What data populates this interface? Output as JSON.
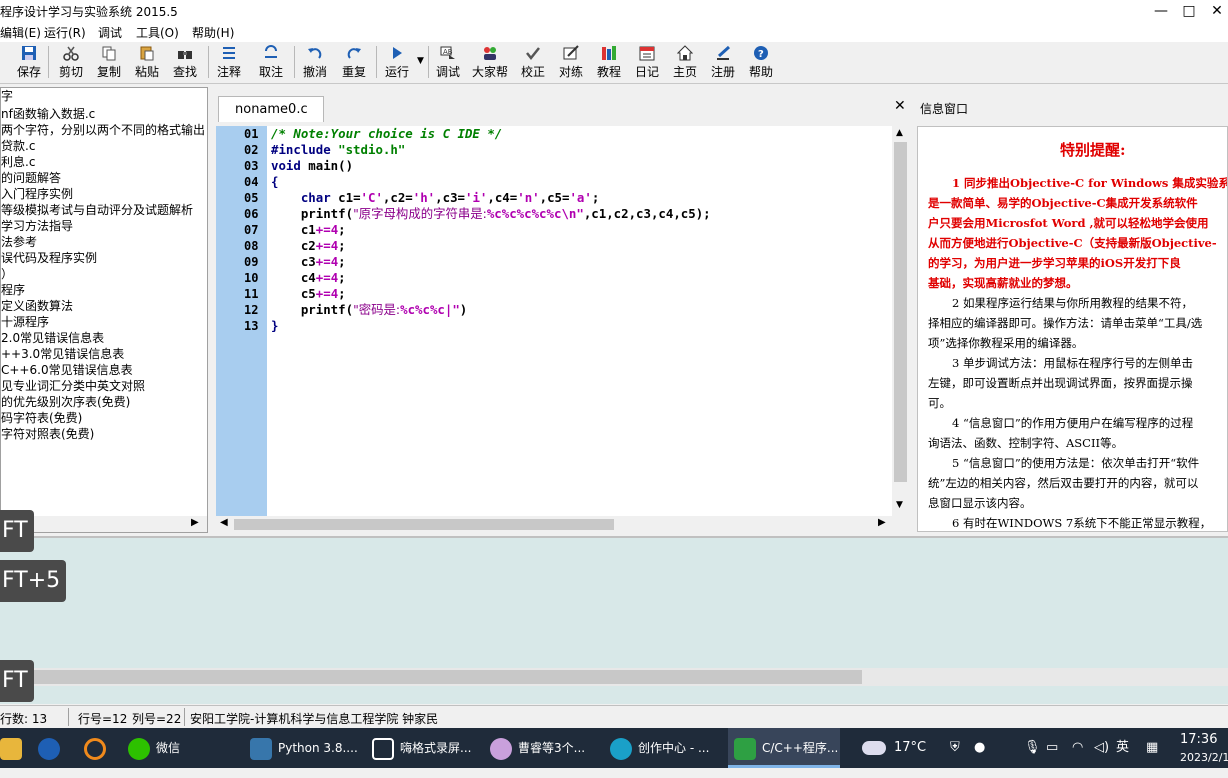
{
  "window": {
    "title": "程序设计学习与实验系统 2015.5",
    "controls": [
      "—",
      "□",
      "✕"
    ]
  },
  "menu": [
    {
      "label": "编辑(E)"
    },
    {
      "label": "运行(R)"
    },
    {
      "label": "调试"
    },
    {
      "label": "工具(O)"
    },
    {
      "label": "帮助(H)"
    }
  ],
  "toolbar": [
    {
      "label": "保存",
      "icon": "save-icon"
    },
    {
      "label": "剪切",
      "icon": "cut-icon"
    },
    {
      "label": "复制",
      "icon": "copy-icon"
    },
    {
      "label": "粘贴",
      "icon": "paste-icon"
    },
    {
      "label": "查找",
      "icon": "find-icon"
    },
    {
      "label": "注释",
      "icon": "comment-icon"
    },
    {
      "label": "取注",
      "icon": "uncomment-icon"
    },
    {
      "label": "撤消",
      "icon": "undo-icon"
    },
    {
      "label": "重复",
      "icon": "redo-icon"
    },
    {
      "label": "运行",
      "icon": "run-icon"
    },
    {
      "label": "调试",
      "icon": "debug-icon"
    },
    {
      "label": "大家帮",
      "icon": "help-community-icon"
    },
    {
      "label": "校正",
      "icon": "check-icon"
    },
    {
      "label": "对练",
      "icon": "practice-icon"
    },
    {
      "label": "教程",
      "icon": "tutorial-icon"
    },
    {
      "label": "日记",
      "icon": "diary-icon"
    },
    {
      "label": "主页",
      "icon": "home-icon"
    },
    {
      "label": "注册",
      "icon": "register-icon"
    },
    {
      "label": "帮助",
      "icon": "help-icon"
    }
  ],
  "tree": [
    "字",
    "nf函数输入数据.c",
    "两个字符，分别以两个不同的格式输出",
    "贷款.c",
    "利息.c",
    "的问题解答",
    "入门程序实例",
    "等级模拟考试与自动评分及试题解析",
    "学习方法指导",
    "法参考",
    "误代码及程序实例",
    "）",
    "程序",
    "定义函数算法",
    "十源程序",
    "2.0常见错误信息表",
    "++3.0常见错误信息表",
    "C++6.0常见错误信息表",
    "见专业词汇分类中英文对照",
    "的优先级别次序表(免费)",
    "码字符表(免费)",
    "字符对照表(免费)"
  ],
  "editor": {
    "tab": "noname0.c",
    "close": "✕",
    "line_numbers": [
      "01",
      "02",
      "03",
      "04",
      "05",
      "06",
      "07",
      "08",
      "09",
      "10",
      "11",
      "12",
      "13"
    ]
  },
  "info": {
    "title": "信息窗口",
    "heading": "特别提醒:",
    "red_lines": [
      "1 同步推出Objective-C for Windows 集成实验系",
      "是一款简单、易学的Objective-C集成开发系统软件",
      "户只要会用Microsfot Word ,就可以轻松地学会使用",
      "从而方便地进行Objective-C（支持最新版Objective-",
      "的学习，为用户进一步学习苹果的iOS开发打下良",
      "基础，实现高薪就业的梦想。"
    ],
    "black_lines": [
      "2 如果程序运行结果与你所用教程的结果不符，",
      "择相应的编译器即可。操作方法：请单击菜单“工具/选",
      "项”选择你教程采用的编译器。",
      "3 单步调试方法：用鼠标在程序行号的左侧单击",
      "左键，即可设置断点并出现调试界面，按界面提示操",
      "可。",
      "4 “信息窗口”的作用方便用户在编写程序的过程",
      "询语法、函数、控制字符、ASCII等。",
      "5 “信息窗口”的使用方法是：依次单击打开“软件",
      "统”左边的相关内容，然后双击要打开的内容，就可以",
      "息窗口显示该内容。",
      "6 有时在WINDOWS 7系统下不能正常显示教程，"
    ]
  },
  "keys": [
    "FT",
    "FT+5",
    "FT"
  ],
  "status": {
    "lines": "行数:  13",
    "row": "行号=12",
    "col": "列号=22",
    "org": "安阳工学院-计算机科学与信息工程学院    钟家民"
  },
  "taskbar": [
    {
      "label": "Python 3.8....",
      "icon": "python-icon"
    },
    {
      "label": "嗨格式录屏...",
      "icon": "recorder-icon"
    },
    {
      "label": "曹睿等3个...",
      "icon": "chat-icon"
    },
    {
      "label": "创作中心 - ...",
      "icon": "edge-icon"
    },
    {
      "label": "C/C++程序...",
      "icon": "c-ide-icon"
    }
  ],
  "wechat": "微信",
  "tray": {
    "weather": "17°C",
    "ime": "英",
    "time": "17:36",
    "date": "2023/2/1"
  },
  "colors": {
    "gutter": "#a8cdef",
    "output": "#d8e8e8",
    "red": "#e00000",
    "taskbar": "#1f2b3a"
  }
}
